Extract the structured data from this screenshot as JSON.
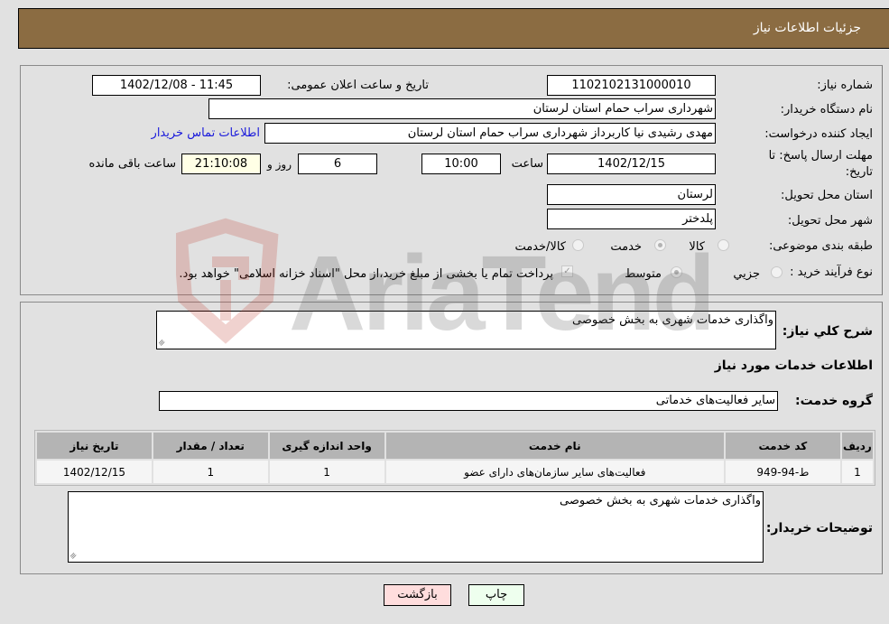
{
  "header": {
    "title": "جزئیات اطلاعات نیاز"
  },
  "details": {
    "need_number": {
      "label": "شماره نیاز:",
      "value": "1102102131000010"
    },
    "announce_datetime": {
      "label": "تاریخ و ساعت اعلان عمومی:",
      "value": "1402/12/08 - 11:45"
    },
    "buyer_org": {
      "label": "نام دستگاه خریدار:",
      "value": "شهرداری سراب حمام استان لرستان"
    },
    "requester": {
      "label": "ایجاد کننده درخواست:",
      "value": "مهدی رشیدی نیا کاربرداز شهرداری سراب حمام استان لرستان"
    },
    "buyer_contact_link": "اطلاعات تماس خریدار",
    "deadline": {
      "label": "مهلت ارسال پاسخ: تا تاریخ:",
      "date": "1402/12/15",
      "time_label": "ساعت",
      "time": "10:00",
      "days": "6",
      "days_label": "روز و",
      "remaining": "21:10:08",
      "remaining_label": "ساعت باقی مانده"
    },
    "delivery_province": {
      "label": "استان محل تحویل:",
      "value": "لرستان"
    },
    "delivery_city": {
      "label": "شهر محل تحویل:",
      "value": "پلدختر"
    },
    "category": {
      "label": "طبقه بندی موضوعی:",
      "options": [
        "کالا",
        "خدمت",
        "کالا/خدمت"
      ],
      "selected": "خدمت"
    },
    "purchase_type": {
      "label": "نوع فرآیند خرید :",
      "options": [
        "جزیي",
        "متوسط"
      ],
      "selected": "متوسط",
      "treasury_checkbox_checked": true,
      "treasury_note": "پرداخت تمام یا بخشی از مبلغ خرید،از محل \"اسناد خزانه اسلامی\" خواهد بود."
    }
  },
  "summary": {
    "general_desc_label": "شرح کلي نیاز:",
    "general_desc": "واگذاری خدمات شهری به بخش خصوصی",
    "services_info_title": "اطلاعات خدمات مورد نیاز",
    "service_group_label": "گروه خدمت:",
    "service_group": "سایر فعالیت‌های خدماتی"
  },
  "services_table": {
    "columns": [
      "ردیف",
      "کد خدمت",
      "نام خدمت",
      "واحد اندازه گیری",
      "تعداد / مقدار",
      "تاریخ نیاز"
    ],
    "rows": [
      [
        "1",
        "ط-94-949",
        "فعالیت‌های سایر سازمان‌های دارای عضو",
        "1",
        "1",
        "1402/12/15"
      ]
    ]
  },
  "buyer_notes": {
    "label": "توضیحات خریدار:",
    "value": "واگذاری خدمات شهری به بخش خصوصی"
  },
  "buttons": {
    "print": "چاپ",
    "back": "بازگشت"
  },
  "watermark": {
    "text": "AriaTender.neT"
  },
  "colors": {
    "header_bg": "#8b6c42",
    "back_button_bg": "#ffdddd",
    "print_button_bg": "#eeffee",
    "link": "#1a1adb"
  }
}
